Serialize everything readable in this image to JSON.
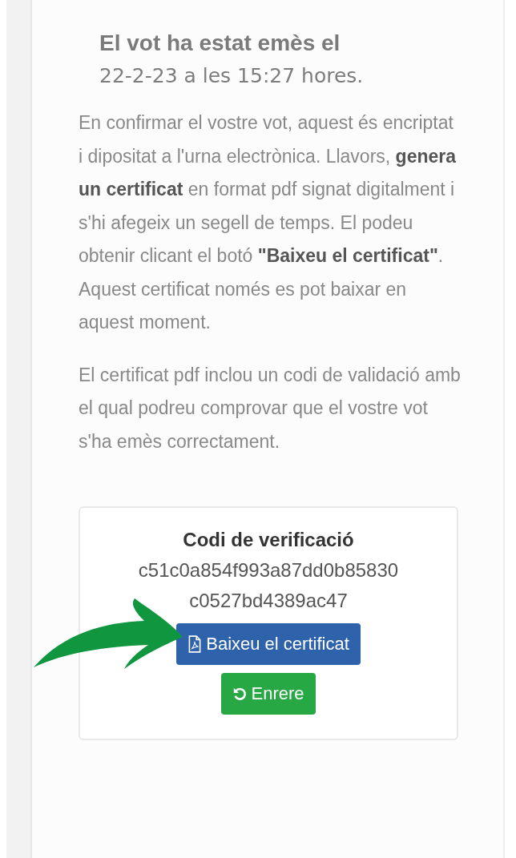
{
  "heading": {
    "title": "El vot ha estat emès el",
    "datetime": "22-2-23 a les 15:27 hores."
  },
  "paragraphs": [
    "En confirmar el vostre vot, aquest és encriptat i dipositat a l'urna electrònica. Llavors, **genera un certificat** en format pdf signat digitalment i s'hi afegeix un segell de temps. El podeu obtenir clicant el botó **\"Baixeu el certificat\"**. Aquest certificat només es pot baixar en aquest moment.",
    "El certificat pdf inclou un codi de validació amb el qual podreu comprovar que el vostre vot s'ha emès correctament."
  ],
  "verification": {
    "title": "Codi de verificació",
    "code_lines": [
      "c51c0a854f993a87dd0b85830",
      "c0527bd4389ac47"
    ]
  },
  "buttons": [
    {
      "kind": "download",
      "label": "Baixeu el certificat"
    },
    {
      "kind": "back",
      "label": "Enrere"
    }
  ]
}
